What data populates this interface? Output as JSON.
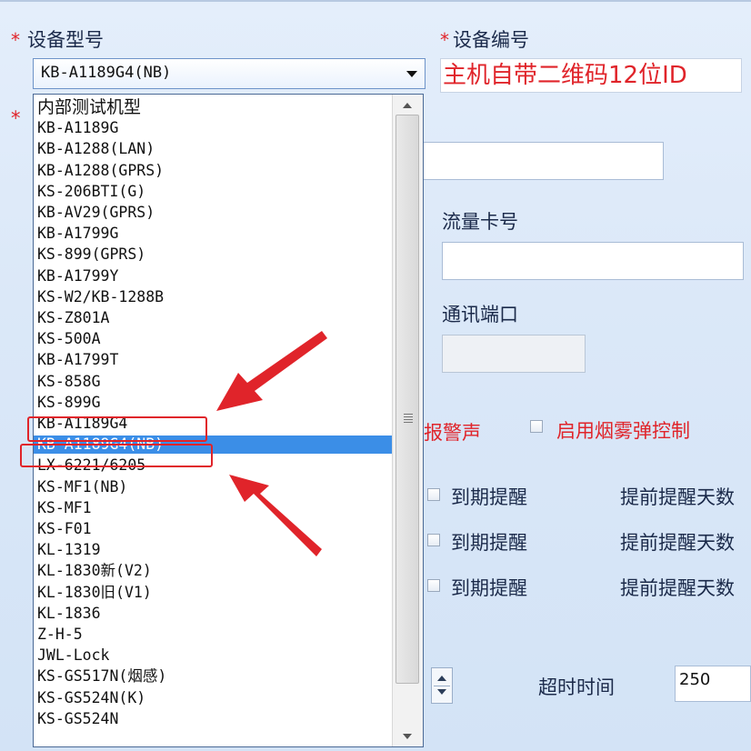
{
  "form": {
    "device_model_label": "设备型号",
    "device_id_label": "设备编号",
    "required_star": "*",
    "selected_model": "KB-A1189G4(NB)",
    "device_id_hint": "主机自带二维码12位ID",
    "sim_label": "流量卡号",
    "port_label": "通讯端口",
    "alarm_sound_partial": "报警声",
    "smoke_control_label": "启用烟雾弹控制",
    "expiry_label": "到期提醒",
    "advance_days_label": "提前提醒天数",
    "timeout_label": "超时时间",
    "timeout_value": "250"
  },
  "dropdown": {
    "items": [
      "内部测试机型",
      "KB-A1189G",
      "KB-A1288(LAN)",
      "KB-A1288(GPRS)",
      "KS-206BTI(G)",
      "KB-AV29(GPRS)",
      "KB-A1799G",
      "KS-899(GPRS)",
      "KB-A1799Y",
      "KS-W2/KB-1288B",
      "KS-Z801A",
      "KS-500A",
      "KB-A1799T",
      "KS-858G",
      "KS-899G",
      "KB-A1189G4",
      "KB-A1189G4(NB)",
      "LX-6221/6205",
      "KS-MF1(NB)",
      "KS-MF1",
      "KS-F01",
      "KL-1319",
      "KL-1830新(V2)",
      "KL-1830旧(V1)",
      "KL-1836",
      "Z-H-5",
      "JWL-Lock",
      "KS-GS517N(烟感)",
      "KS-GS524N(K)",
      "KS-GS524N"
    ],
    "selected_index": 16,
    "highlighted_indices": [
      15,
      16
    ]
  },
  "colors": {
    "accent_red": "#e0242a",
    "selection_blue": "#3b8ee7"
  }
}
